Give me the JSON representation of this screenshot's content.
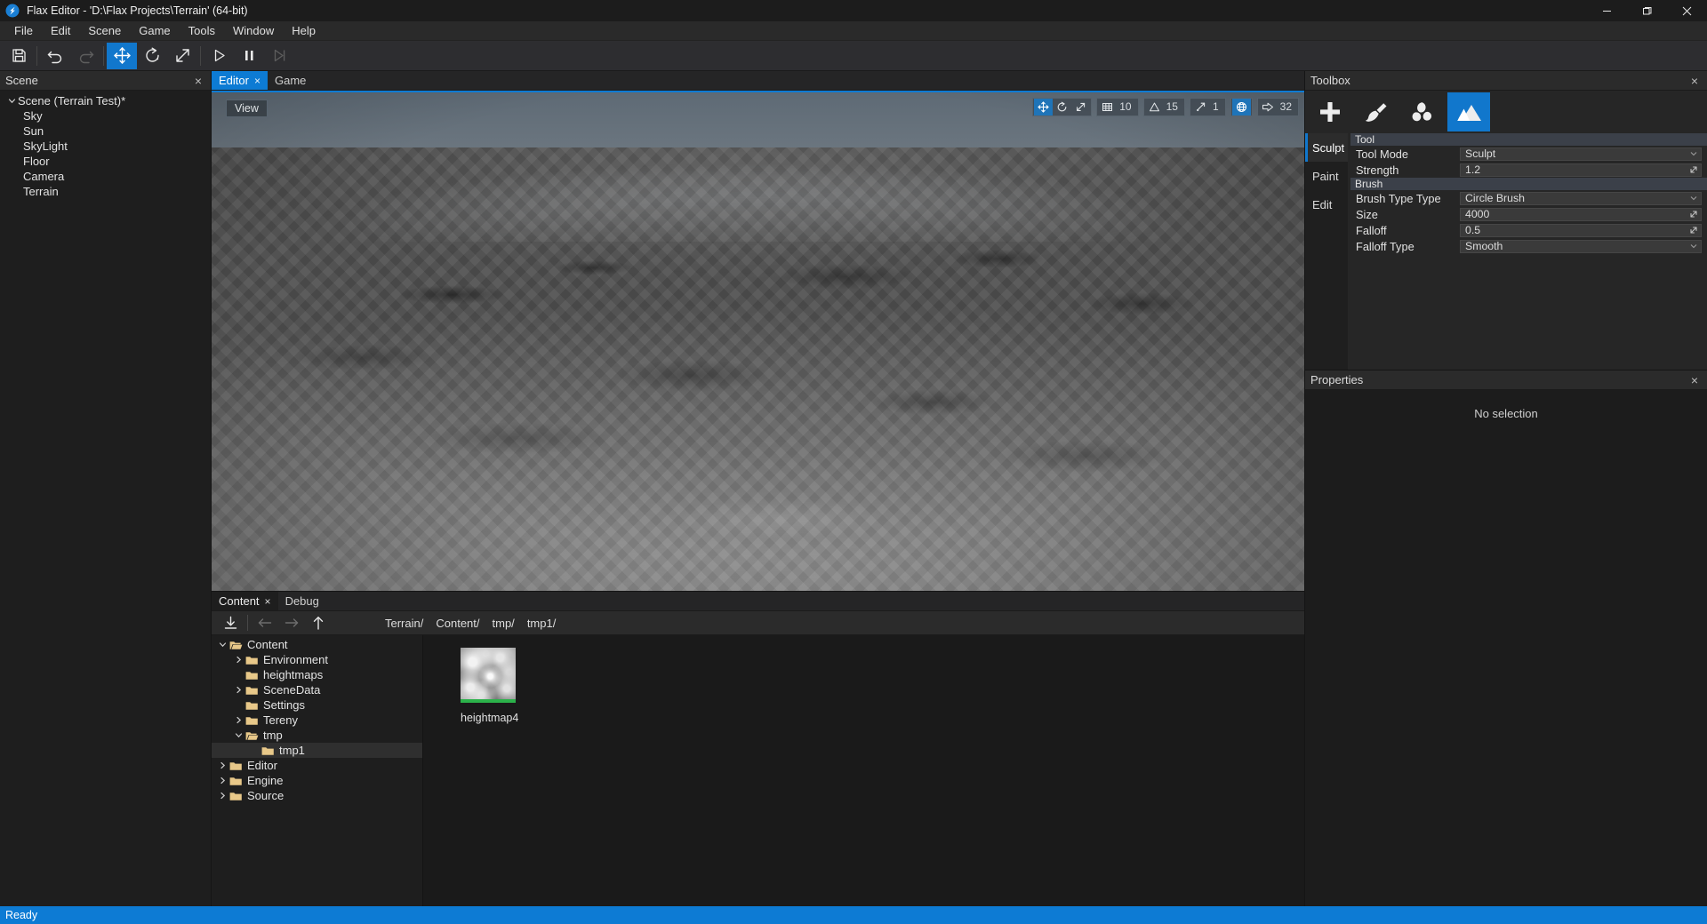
{
  "window": {
    "title": "Flax Editor - 'D:\\Flax Projects\\Terrain' (64-bit)",
    "minimize": "–",
    "maximize": "❐",
    "close": "×"
  },
  "menubar": {
    "items": [
      "File",
      "Edit",
      "Scene",
      "Game",
      "Tools",
      "Window",
      "Help"
    ]
  },
  "toolbar": {
    "buttons": [
      {
        "name": "save-button",
        "icon": "save-icon",
        "state": "normal"
      },
      {
        "name": "undo-button",
        "icon": "undo-icon",
        "state": "normal"
      },
      {
        "name": "redo-button",
        "icon": "redo-icon",
        "state": "disabled"
      },
      {
        "name": "translate-gizmo-button",
        "icon": "move-icon",
        "state": "selected"
      },
      {
        "name": "rotate-gizmo-button",
        "icon": "rotate-icon",
        "state": "normal"
      },
      {
        "name": "scale-gizmo-button",
        "icon": "scale-icon",
        "state": "normal"
      },
      {
        "name": "play-button",
        "icon": "play-icon",
        "state": "normal"
      },
      {
        "name": "pause-button",
        "icon": "pause-icon",
        "state": "normal"
      },
      {
        "name": "step-button",
        "icon": "step-forward-icon",
        "state": "disabled"
      }
    ]
  },
  "scene_panel": {
    "title": "Scene",
    "close": "×",
    "root": "Scene (Terrain Test)*",
    "children": [
      "Sky",
      "Sun",
      "SkyLight",
      "Floor",
      "Camera",
      "Terrain"
    ]
  },
  "viewport": {
    "tabs": [
      {
        "label": "Editor",
        "active": true,
        "closable": true,
        "close": "×"
      },
      {
        "label": "Game",
        "active": false,
        "closable": false
      }
    ],
    "view_button": "View",
    "overlay": {
      "transform_mode_icon": "move-icon",
      "rotate_icon": "rotate-icon",
      "scale_icon": "scale-icon",
      "grid_icon": "grid-icon",
      "grid_value": "10",
      "angle_icon": "angle-snap-icon",
      "angle_value": "15",
      "scale_snap_icon": "scale-snap-icon",
      "scale_snap_value": "1",
      "globe_icon": "globe-icon",
      "speed_icon": "camera-speed-icon",
      "speed_value": "32"
    }
  },
  "content_panel": {
    "tabs": [
      {
        "label": "Content",
        "active": true,
        "closable": true,
        "close": "×"
      },
      {
        "label": "Debug",
        "active": false,
        "closable": false
      }
    ],
    "toolbar": {
      "import_icon": "import-icon",
      "back_icon": "arrow-left-icon",
      "forward_icon": "arrow-right-icon",
      "up_icon": "arrow-up-icon"
    },
    "breadcrumbs": [
      "Terrain/",
      "Content/",
      "tmp/",
      "tmp1/"
    ],
    "tree": [
      {
        "label": "Content",
        "depth": 0,
        "expandable": true,
        "expanded": true,
        "selected": false
      },
      {
        "label": "Environment",
        "depth": 1,
        "expandable": true,
        "expanded": false,
        "selected": false
      },
      {
        "label": "heightmaps",
        "depth": 1,
        "expandable": false,
        "expanded": false,
        "selected": false
      },
      {
        "label": "SceneData",
        "depth": 1,
        "expandable": true,
        "expanded": false,
        "selected": false
      },
      {
        "label": "Settings",
        "depth": 1,
        "expandable": false,
        "expanded": false,
        "selected": false
      },
      {
        "label": "Tereny",
        "depth": 1,
        "expandable": true,
        "expanded": false,
        "selected": false
      },
      {
        "label": "tmp",
        "depth": 1,
        "expandable": true,
        "expanded": true,
        "selected": false
      },
      {
        "label": "tmp1",
        "depth": 2,
        "expandable": false,
        "expanded": false,
        "selected": true
      },
      {
        "label": "Editor",
        "depth": 0,
        "expandable": true,
        "expanded": false,
        "selected": false
      },
      {
        "label": "Engine",
        "depth": 0,
        "expandable": true,
        "expanded": false,
        "selected": false
      },
      {
        "label": "Source",
        "depth": 0,
        "expandable": true,
        "expanded": false,
        "selected": false
      }
    ],
    "assets": [
      {
        "name": "heightmap4",
        "type": "texture",
        "status_color": "#2bb24a"
      }
    ]
  },
  "toolbox": {
    "title": "Toolbox",
    "close": "×",
    "tool_tabs": [
      {
        "name": "spawn-tool",
        "icon": "plus-icon",
        "selected": false
      },
      {
        "name": "paint-tool",
        "icon": "brush-icon",
        "selected": false
      },
      {
        "name": "foliage-tool",
        "icon": "foliage-icon",
        "selected": false
      },
      {
        "name": "terrain-tool",
        "icon": "mountain-icon",
        "selected": true
      }
    ],
    "modes": [
      {
        "label": "Sculpt",
        "selected": true
      },
      {
        "label": "Paint",
        "selected": false
      },
      {
        "label": "Edit",
        "selected": false
      }
    ],
    "groups": [
      {
        "header": "Tool",
        "rows": [
          {
            "label": "Tool Mode",
            "value": "Sculpt",
            "control": "dropdown"
          },
          {
            "label": "Strength",
            "value": "1.2",
            "control": "slider"
          }
        ]
      },
      {
        "header": "Brush",
        "rows": [
          {
            "label": "Brush Type Type",
            "value": "Circle Brush",
            "control": "dropdown"
          },
          {
            "label": "Size",
            "value": "4000",
            "control": "slider"
          },
          {
            "label": "Falloff",
            "value": "0.5",
            "control": "slider"
          },
          {
            "label": "Falloff Type",
            "value": "Smooth",
            "control": "dropdown"
          }
        ]
      }
    ]
  },
  "properties_panel": {
    "title": "Properties",
    "close": "×",
    "empty_text": "No selection"
  },
  "status_bar": {
    "text": "Ready"
  },
  "colors": {
    "accent": "#0d7bd4",
    "selected_tool": "#1177cc",
    "asset_ok": "#2bb24a",
    "panel_bg": "#262626",
    "window_bg": "#1e1e1e"
  }
}
